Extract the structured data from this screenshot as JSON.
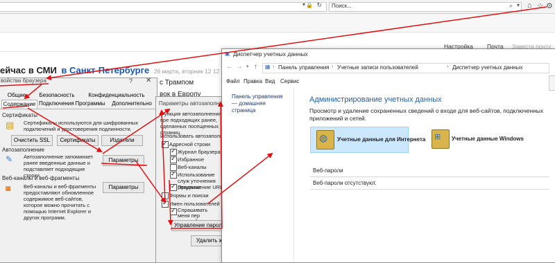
{
  "browser": {
    "search_placeholder": "Поиск...",
    "nav_links": [
      "Настройка",
      "Почта",
      "Завести почту"
    ]
  },
  "background_page": {
    "headline_part1": "ейчас в СМИ",
    "headline_part2": "в Санкт-Петербурге",
    "date": "26 марта, вторник 12 12",
    "news_1": "с Трампом",
    "news_2": "вок в Европу"
  },
  "internet_options": {
    "title_partial": "войства браузера",
    "tabs_row1": [
      "Общие",
      "Безопасность",
      "Конфиденциальность"
    ],
    "tabs_row2": [
      "Содержание",
      "Подключения",
      "Программы",
      "Дополнительно"
    ],
    "certificates": {
      "header": "Сертификаты",
      "text": "Сертификаты используются для шифрованных подключений и удостоверения подлинности.",
      "buttons": [
        "Очистить SSL",
        "Сертификаты",
        "Издатели"
      ]
    },
    "autocomplete": {
      "header": "Автозаполнение",
      "text": "Автозаполнение запоминает ранее введенные данные и подставляет подходящие строки.",
      "button": "Параметры"
    },
    "feeds": {
      "header": "Веб-каналы и веб-фрагменты",
      "text": "Веб-каналы и веб-фрагменты предоставляют обновленное содержимое веб-сайтов, которое можно прочитать с помощью Internet Explorer и других программ.",
      "button": "Параметры"
    }
  },
  "autocomplete_settings": {
    "title": "Параметры автозаполнения",
    "desc": "Функция автозаполнения пре подходящих ранее, сделанных посещенных страниц.",
    "use_for": "Использовать автозаполне",
    "items": [
      {
        "label": "Адресной строки",
        "checked": true
      },
      {
        "label": "Журнал браузера",
        "checked": true
      },
      {
        "label": "Избранное",
        "checked": true
      },
      {
        "label": "Веб-каналы",
        "checked": false
      },
      {
        "label": "Использование служ уточнения результат",
        "checked": true
      },
      {
        "label": "Предложение URL-ад",
        "checked": true
      },
      {
        "label": "Формы и поиски",
        "checked": false
      },
      {
        "label": "Имен пользователей и па",
        "checked": true
      },
      {
        "label": "Спрашивать меня пер паролей",
        "checked": true
      }
    ],
    "manage_passwords": "Управление паролями",
    "delete_button": "Удалить жу"
  },
  "credential_manager": {
    "title": "Диспетчер учетных данных",
    "breadcrumb": [
      "Панель управления",
      "Учетные записи пользователей",
      "Диспетчер учетных данных"
    ],
    "menu": [
      "Файл",
      "Правка",
      "Вид",
      "Сервис"
    ],
    "sidebar_link": "Панель управления — домашняя страница",
    "heading": "Администрирование учетных данных",
    "description": "Просмотр и удаление сохраненных сведений о входе для веб-сайтов, подключенных приложений и сетей.",
    "web_credentials": "Учетные данные для Интернета",
    "windows_credentials": "Учетные данные Windows",
    "section_title": "Веб-пароли",
    "empty_text": "Веб-пароли отсутствуют."
  },
  "colors": {
    "annotation": "#e01010",
    "link_blue": "#1a56b0",
    "heading_blue": "#1f5fa8",
    "selection": "#cce8ff"
  }
}
